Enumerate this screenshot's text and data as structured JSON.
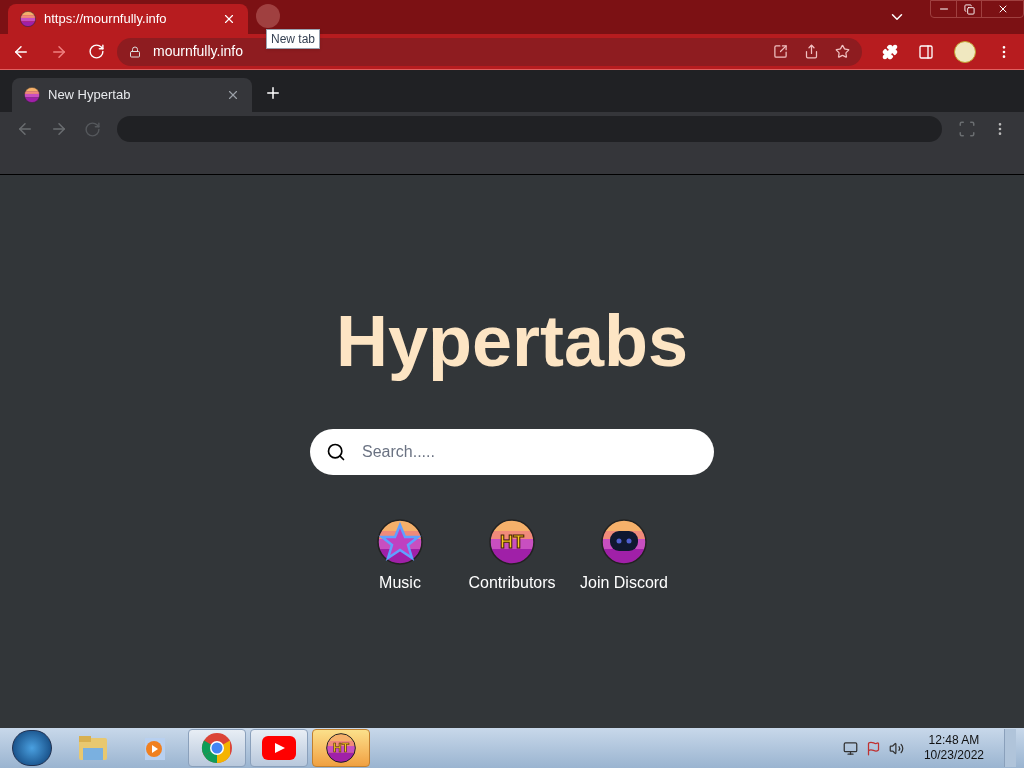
{
  "outer_tab": {
    "title": "https://mournfully.info",
    "selected": true
  },
  "tooltip": "New tab",
  "outer_address": "mournfully.info",
  "inner_tab": {
    "title": "New Hypertab",
    "selected": true
  },
  "heading": "Hypertabs",
  "search": {
    "placeholder": "Search....."
  },
  "shortcuts": [
    {
      "label": "Music",
      "kind": "star"
    },
    {
      "label": "Contributors",
      "kind": "logo",
      "logo_text": "HT"
    },
    {
      "label": "Join Discord",
      "kind": "controller"
    }
  ],
  "taskbar": {
    "apps": [
      {
        "kind": "folder",
        "selected": false
      },
      {
        "kind": "media",
        "selected": false
      },
      {
        "kind": "chrome",
        "selected": true
      },
      {
        "kind": "youtube",
        "selected": true
      },
      {
        "kind": "logo",
        "logo_text": "HT",
        "selected": true
      }
    ],
    "time": "12:48 AM",
    "date": "10/23/2022"
  }
}
